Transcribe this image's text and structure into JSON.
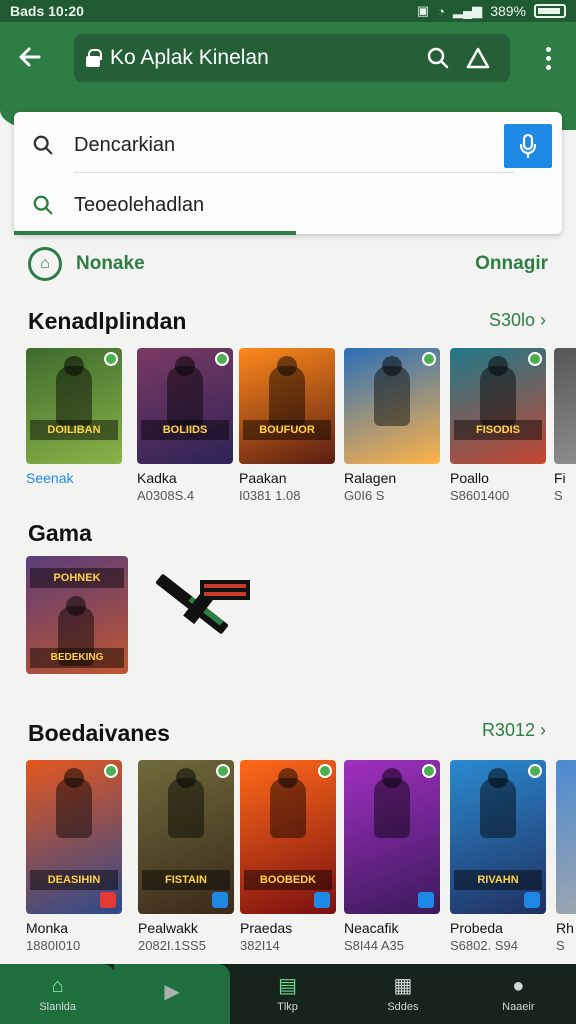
{
  "status_bar": {
    "time": "Bads 10:20",
    "battery": "389%"
  },
  "header": {
    "url_title": "Ko Aplak Kinelan"
  },
  "search": {
    "query": "Dencarkian",
    "suggestion": "Teoeolehadlan"
  },
  "home_row": {
    "label": "Nonake",
    "link": "Onnagir"
  },
  "section1": {
    "title": "Kenadlplindan",
    "see_more": "S30lo",
    "items": [
      {
        "title": "Seenak",
        "meta": "",
        "c1": "#3e6b2e",
        "c2": "#8ab348",
        "banner": "DOILIBAN"
      },
      {
        "title": "Kadka",
        "meta": "A0308S.4",
        "c1": "#7a3a63",
        "c2": "#2e2357",
        "banner": "BOLIIDS"
      },
      {
        "title": "Paakan",
        "meta": "I0381 1.08",
        "c1": "#ff8a1c",
        "c2": "#5a1e12",
        "banner": "BOUFUOR"
      },
      {
        "title": "Ralagen",
        "meta": "G0I6 S",
        "c1": "#2a6fb8",
        "c2": "#ffb347",
        "banner": ""
      },
      {
        "title": "Poallo",
        "meta": "S8601400",
        "c1": "#1f7a8a",
        "c2": "#c54530",
        "banner": "FISODIS"
      },
      {
        "title": "Fi",
        "meta": "S",
        "c1": "#555555",
        "c2": "#999999",
        "banner": ""
      }
    ]
  },
  "section2": {
    "title": "Gama",
    "tile_banner": "POHNEK",
    "tile_label": "BEDEKING"
  },
  "section3": {
    "title": "Boedaivanes",
    "see_more": "R3012",
    "items": [
      {
        "title": "Monka",
        "meta": "1880I010",
        "c1": "#e4571f",
        "c2": "#2d4a8c",
        "banner": "DEASIHIN"
      },
      {
        "title": "Pealwakk",
        "meta": "2082I.1SS5",
        "c1": "#6f6a3a",
        "c2": "#3a2a1a",
        "banner": "FISTAIN"
      },
      {
        "title": "Praedas",
        "meta": "382I14",
        "c1": "#ff6a1a",
        "c2": "#7a1010",
        "banner": "BOOBEDK"
      },
      {
        "title": "Neacafik",
        "meta": "S8I44 A35",
        "c1": "#a030c0",
        "c2": "#3a1a5a",
        "banner": ""
      },
      {
        "title": "Probeda",
        "meta": "S6802. S94",
        "c1": "#2a8ad0",
        "c2": "#203060",
        "banner": "RIVAHN"
      },
      {
        "title": "Rh",
        "meta": "S",
        "c1": "#4a8ad0",
        "c2": "#aaaaaa",
        "banner": ""
      }
    ]
  },
  "bottom_nav": {
    "items": [
      {
        "label": "Slanlda",
        "icon": "home-icon"
      },
      {
        "label": "",
        "icon": "play-icon"
      },
      {
        "label": "Tlkp",
        "icon": "apps-icon"
      },
      {
        "label": "Sddes",
        "icon": "movie-icon"
      },
      {
        "label": "Naaeir",
        "icon": "info-icon"
      }
    ]
  }
}
